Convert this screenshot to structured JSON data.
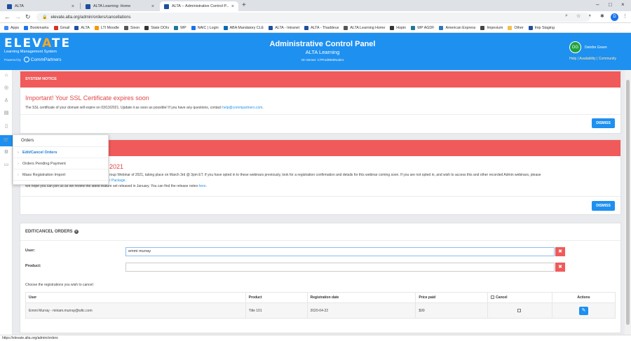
{
  "browser": {
    "tabs": [
      {
        "title": "ALTA",
        "favicon_color": "#1e4fa0"
      },
      {
        "title": "ALTA Learning: Home",
        "favicon_color": "#1e4fa0"
      },
      {
        "title": "ALTA -- Administrative Control P...",
        "favicon_color": "#1e4fa0"
      }
    ],
    "url": "elevate.alta.org/admin/orders/cancellations",
    "profile_initial": "D",
    "bookmarks": [
      {
        "label": "Apps",
        "color": "#4285f4"
      },
      {
        "label": "Bookmarks",
        "color": "#1a73e8"
      },
      {
        "label": "Gmail",
        "color": "#d93025"
      },
      {
        "label": "ALTA",
        "color": "#1e4fa0"
      },
      {
        "label": "LTI Moodle",
        "color": "#f29900"
      },
      {
        "label": "Sixon",
        "color": "#555555"
      },
      {
        "label": "State DOIs",
        "color": "#333333"
      },
      {
        "label": "WP",
        "color": "#21759b"
      },
      {
        "label": "NAIC | Login",
        "color": "#1a73e8"
      },
      {
        "label": "ABA Mandatory CLE",
        "color": "#0a6ab4"
      },
      {
        "label": "ALTA - Intranet",
        "color": "#1e4fa0"
      },
      {
        "label": "ALTA - Thaddeus",
        "color": "#1e4fa0"
      },
      {
        "label": "ALTA Learning Home",
        "color": "#555555"
      },
      {
        "label": "Hopin",
        "color": "#333333"
      },
      {
        "label": "WP AGDF",
        "color": "#21759b"
      },
      {
        "label": "American Express",
        "color": "#2e77bc"
      },
      {
        "label": "Impexium",
        "color": "#444444"
      },
      {
        "label": "Other",
        "color": "#f2c04c"
      },
      {
        "label": "Imp Staging",
        "color": "#1e4fa0"
      }
    ],
    "status_url": "https://elevate.alta.org/admin/orders"
  },
  "header": {
    "logo_pre": "ELEV",
    "logo_tri": "A",
    "logo_post": "TE",
    "logo_subtitle": "Learning Management System",
    "powered_by": "Powered by",
    "partner": "CommPartners",
    "title": "Administrative Control Panel",
    "org": "ALTA Learning",
    "server": "On Server: C7ProdWebNode1",
    "user_initials": "DG",
    "user_name": "Deirdre Green",
    "links": "Help | Availability | Community"
  },
  "flyout": {
    "title": "Orders",
    "items": [
      "Edit/Cancel Orders",
      "Orders Pending Payment",
      "Mass Registration Import"
    ]
  },
  "notice1": {
    "header": "SYSTEM NOTICE",
    "title": "Important! Your SSL Certificate expires soon",
    "body_pre": "The SSL certificate of your domain will expire on 03/13/2021. Update it as soon as possible! If you have any questions, contact ",
    "email": "help@commpartners.com",
    "body_post": ".",
    "dismiss": "DISMISS"
  },
  "notice2": {
    "title_visible": "2021",
    "body_line1": "roup Webinar of 2021, taking place on March 3rd @ 3pm ET. If you have opted in to these webinars previously, look for a registration confirmation and details for this webinar coming soon. If you are not opted in, and wish to access this and other recorded Admin webinars, please",
    "body_link": "r Package.",
    "body_line3_pre": "We hope you can join us as we review the latest feature set released in January. You can find the release notes ",
    "body_line3_link": "here",
    "body_line3_post": ".",
    "dismiss": "DISMISS"
  },
  "orders": {
    "title": "EDIT/CANCEL ORDERS",
    "user_label": "User:",
    "user_value": "emmi murray",
    "product_label": "Product:",
    "product_value": "",
    "choose_text": "Choose the registrations you wish to cancel:",
    "columns": [
      "User",
      "Product",
      "Registration date",
      "Price paid",
      "Cancel",
      "Actions"
    ],
    "rows": [
      {
        "user": "Emmi Murray - miriam.murray@wltc.com",
        "product": "Title 101",
        "date": "2020-04-22",
        "price": "$99"
      }
    ]
  }
}
